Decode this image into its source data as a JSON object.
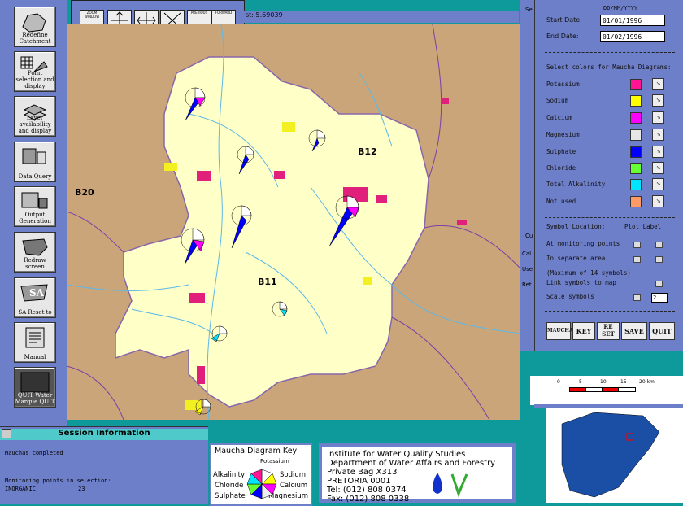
{
  "toolbar": {
    "buttons": [
      {
        "label": "Redefine Catchment",
        "icon": "catchment-map-icon"
      },
      {
        "label": "Point selection and display",
        "icon": "grid-points-icon"
      },
      {
        "label": "Layer availability and display",
        "icon": "layers-icon"
      },
      {
        "label": "Data Query",
        "icon": "data-query-icon"
      },
      {
        "label": "Output Generation",
        "icon": "output-icon"
      },
      {
        "label": "Redraw screen",
        "icon": "redraw-map-icon"
      },
      {
        "label": "SA Reset to",
        "icon": "reset-sa-icon"
      },
      {
        "label": "Manual",
        "icon": "manual-icon"
      },
      {
        "label": "QUIT Water Marque QUIT",
        "icon": "quit-icon"
      }
    ]
  },
  "navbar": {
    "buttons": [
      "ZOOM WINDOW",
      "",
      "",
      "",
      "PREVIOUS",
      "FORWARD"
    ]
  },
  "status": {
    "text": "st: 5.69039"
  },
  "map": {
    "labels": {
      "b12": "B12",
      "b20": "B20",
      "b11": "B11"
    }
  },
  "panel": {
    "date_format": "DD/MM/YYYY",
    "start_label": "Start Date:",
    "start_value": "01/01/1996",
    "end_label": "End Date:",
    "end_value": "01/02/1996",
    "colors_title": "Select colors for Maucha Diagrams:",
    "ions": [
      {
        "name": "Potassium",
        "color": "#ff1493"
      },
      {
        "name": "Sodium",
        "color": "#ffff00"
      },
      {
        "name": "Calcium",
        "color": "#ff00ff"
      },
      {
        "name": "Magnesium",
        "color": "#e6e6e6"
      },
      {
        "name": "Sulphate",
        "color": "#0000ff"
      },
      {
        "name": "Chloride",
        "color": "#66ff33"
      },
      {
        "name": "Total Alkalinity",
        "color": "#00e5ff"
      },
      {
        "name": "Not used",
        "color": "#ff9966"
      }
    ],
    "symbol_location": "Symbol Location:",
    "plot_label": "Plot Label",
    "at_points": "At monitoring points",
    "separate": "In separate area",
    "max_symbols": "(Maximum of 14 symbols)",
    "link": "Link symbols to map",
    "scale": "Scale symbols",
    "scale_value": "2",
    "buttons": [
      "MAUCHA",
      "KEY",
      "RE SET",
      "SAVE",
      "QUIT"
    ],
    "left_strip": [
      "Se",
      "Cu",
      "Cal",
      "Use",
      "Ret"
    ]
  },
  "session": {
    "title": "Session Information",
    "line1": "Mauchas completed",
    "line2": "Monitoring points in selection:",
    "line3_label": "INORGANIC",
    "line3_value": "23"
  },
  "key": {
    "title": "Maucha Diagram Key",
    "potassium": "Potassium",
    "alkalinity": "Alkalinity",
    "sodium": "Sodium",
    "chloride": "Chloride",
    "calcium": "Calcium",
    "sulphate": "Sulphate",
    "magnesium": "Magnesium"
  },
  "institute": {
    "line1": "Institute for Water Quality Studies",
    "line2": "Department of Water Affairs and Forestry",
    "line3": "Private Bag X313",
    "line4": "PRETORIA 0001",
    "line5": "Tel: (012) 808 0374",
    "line6": "Fax: (012) 808 0338"
  },
  "scale": {
    "ticks": [
      "0",
      "5",
      "10",
      "15",
      "20 km"
    ]
  }
}
